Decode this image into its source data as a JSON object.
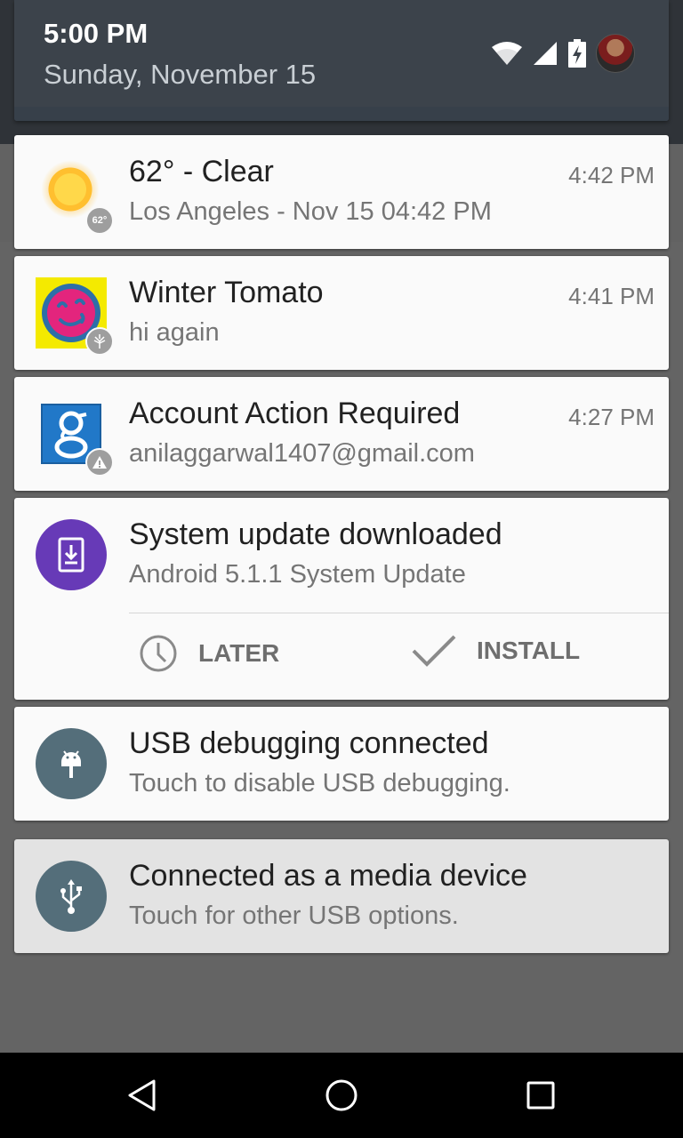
{
  "status": {
    "time": "5:00 PM",
    "date": "Sunday, November 15",
    "icons": [
      "wifi-icon",
      "cell-signal-icon",
      "battery-charging-icon"
    ]
  },
  "notifications": [
    {
      "app": "weather",
      "title": "62° -  Clear",
      "text": "Los Angeles - Nov 15  04:42 PM",
      "time": "4:42 PM",
      "badge": "62°"
    },
    {
      "app": "winter-tomato",
      "title": "Winter Tomato",
      "text": "hi again",
      "time": "4:41 PM"
    },
    {
      "app": "google-account",
      "title": "Account Action Required",
      "text": "anilaggarwal1407@gmail.com",
      "time": "4:27 PM"
    },
    {
      "app": "system-update",
      "title": "System update downloaded",
      "text": "Android 5.1.1 System Update",
      "actions": [
        {
          "label": "LATER",
          "icon": "clock-icon"
        },
        {
          "label": "INSTALL",
          "icon": "check-icon"
        }
      ]
    },
    {
      "app": "usb-debugging",
      "title": "USB debugging connected",
      "text": "Touch to disable USB debugging."
    },
    {
      "app": "media-device",
      "title": "Connected as a media device",
      "text": "Touch for other USB options."
    }
  ],
  "nav": {
    "buttons": [
      "back-icon",
      "home-icon",
      "recents-icon"
    ]
  },
  "colors": {
    "update_purple": "#673ab7",
    "usb_blue": "#546e7a",
    "google_blue": "#2178c8",
    "tomato_yellow": "#f4ea00"
  }
}
